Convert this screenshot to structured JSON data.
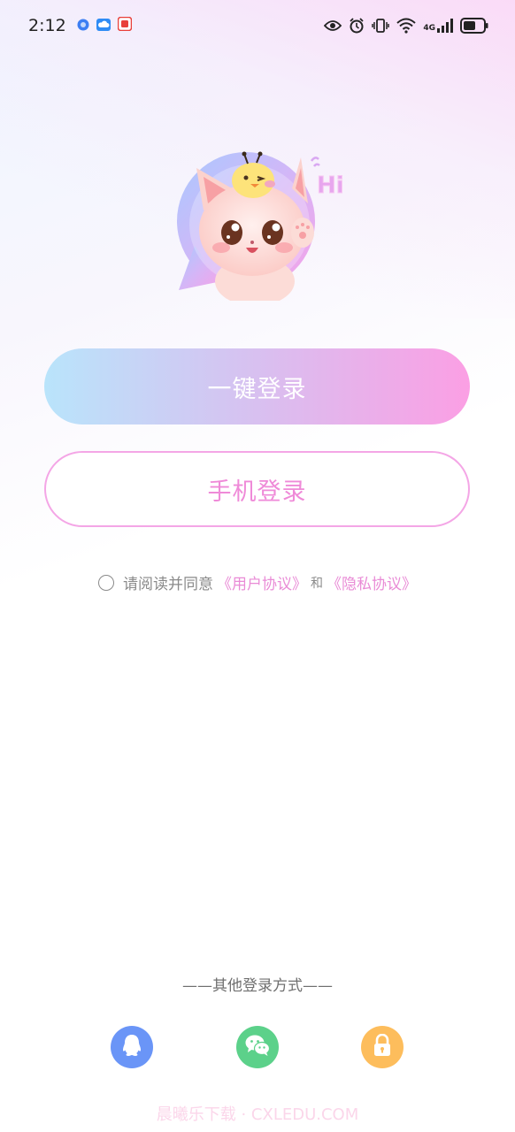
{
  "status_bar": {
    "time": "2:12",
    "network": "4G",
    "icons": [
      "browser-icon",
      "cloud-icon",
      "app-icon",
      "eye-icon",
      "alarm-icon",
      "vibrate-icon",
      "wifi-icon",
      "signal-icon",
      "battery-icon"
    ]
  },
  "mascot": {
    "greeting": "Hi"
  },
  "buttons": {
    "one_key_login": "一键登录",
    "phone_login": "手机登录"
  },
  "agreement": {
    "prefix": "请阅读并同意",
    "user_agreement": "《用户协议》",
    "and": "和",
    "privacy_policy": "《隐私协议》"
  },
  "other_login": {
    "title": "——其他登录方式——",
    "methods": [
      "qq-icon",
      "wechat-icon",
      "lock-icon"
    ]
  },
  "watermark": "晨曦乐下载 · CXLEDU.COM",
  "colors": {
    "accent_pink": "#ef8ad8",
    "gradient_start": "#b9e4fb",
    "gradient_end": "#fb9fe4",
    "qq_blue": "#6a95f7",
    "wechat_green": "#5cd18a",
    "lock_orange": "#fdbd5c"
  }
}
